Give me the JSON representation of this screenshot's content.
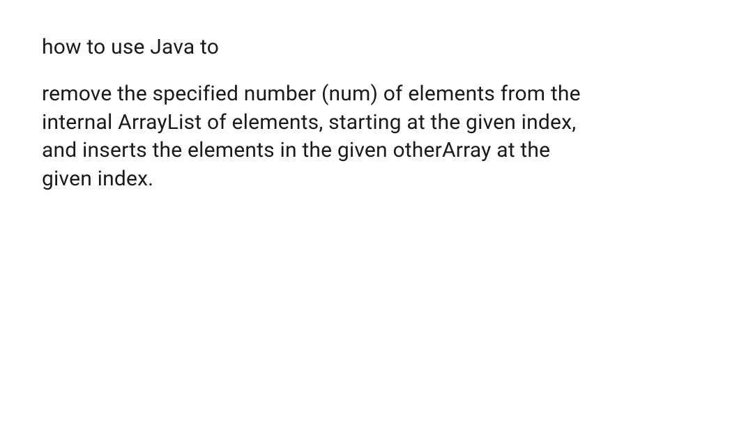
{
  "text": {
    "intro": "how to use Java to",
    "body": "remove the specified number (num) of elements from the internal ArrayList of elements, starting at the given index, and inserts the elements in the given otherArray at the given index."
  }
}
